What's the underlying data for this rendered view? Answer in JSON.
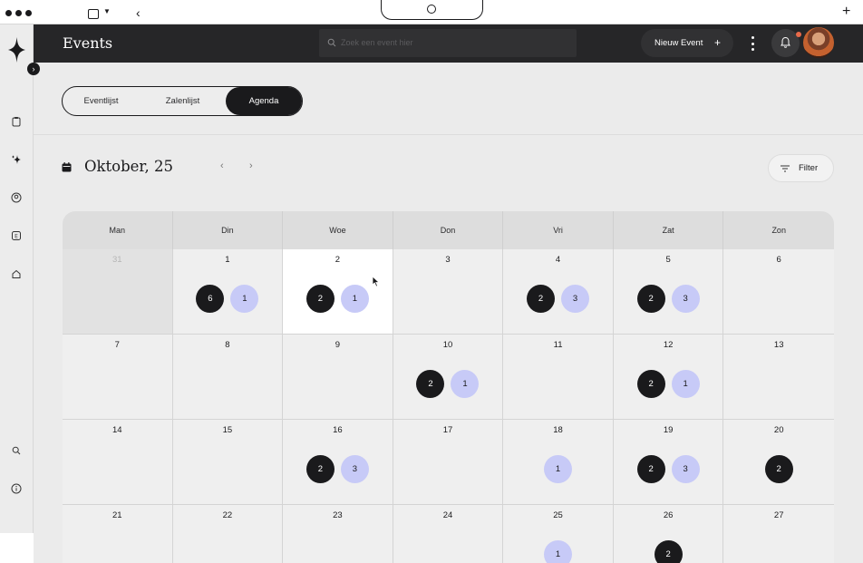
{
  "app": {
    "title": "Events",
    "search_placeholder": "Zoek een event hier",
    "new_event_label": "Nieuw Event",
    "new_event_icon": "plus-icon"
  },
  "views": [
    {
      "label": "Eventlijst",
      "active": false
    },
    {
      "label": "Zalenlijst",
      "active": false
    },
    {
      "label": "Agenda",
      "active": true
    }
  ],
  "calendar": {
    "month_label": "Oktober, 25",
    "filter_label": "Filter",
    "weekdays": [
      "Man",
      "Din",
      "Woe",
      "Don",
      "Vri",
      "Zat",
      "Zon"
    ],
    "days": [
      {
        "n": "31",
        "muted": true,
        "dark": null,
        "light": null
      },
      {
        "n": "1",
        "dark": "6",
        "light": "1"
      },
      {
        "n": "2",
        "dark": "2",
        "light": "1",
        "selected": true
      },
      {
        "n": "3",
        "dark": null,
        "light": null
      },
      {
        "n": "4",
        "dark": "2",
        "light": "3"
      },
      {
        "n": "5",
        "dark": "2",
        "light": "3"
      },
      {
        "n": "6",
        "dark": null,
        "light": null
      },
      {
        "n": "7",
        "dark": null,
        "light": null
      },
      {
        "n": "8",
        "dark": null,
        "light": null
      },
      {
        "n": "9",
        "dark": null,
        "light": null
      },
      {
        "n": "10",
        "dark": "2",
        "light": "1"
      },
      {
        "n": "11",
        "dark": null,
        "light": null
      },
      {
        "n": "12",
        "dark": "2",
        "light": "1"
      },
      {
        "n": "13",
        "dark": null,
        "light": null
      },
      {
        "n": "14",
        "dark": null,
        "light": null
      },
      {
        "n": "15",
        "dark": null,
        "light": null
      },
      {
        "n": "16",
        "dark": "2",
        "light": "3"
      },
      {
        "n": "17",
        "dark": null,
        "light": null
      },
      {
        "n": "18",
        "dark": null,
        "light": "1"
      },
      {
        "n": "19",
        "dark": "2",
        "light": "3"
      },
      {
        "n": "20",
        "dark": "2",
        "light": null
      },
      {
        "n": "21",
        "dark": null,
        "light": null
      },
      {
        "n": "22",
        "dark": null,
        "light": null
      },
      {
        "n": "23",
        "dark": null,
        "light": null
      },
      {
        "n": "24",
        "dark": null,
        "light": null
      },
      {
        "n": "25",
        "dark": null,
        "light": "1"
      },
      {
        "n": "26",
        "dark": "2",
        "light": null
      },
      {
        "n": "27",
        "dark": null,
        "light": null
      }
    ]
  },
  "sidebar_icons": [
    "clipboard-icon",
    "sparkle-icon",
    "user-circle-icon",
    "euro-icon",
    "home-icon",
    "search-icon",
    "info-icon"
  ],
  "colors": {
    "dark": "#1a1a1c",
    "accent_light": "#c7caf7",
    "topbar": "#262628",
    "notification": "#e86a4a"
  }
}
